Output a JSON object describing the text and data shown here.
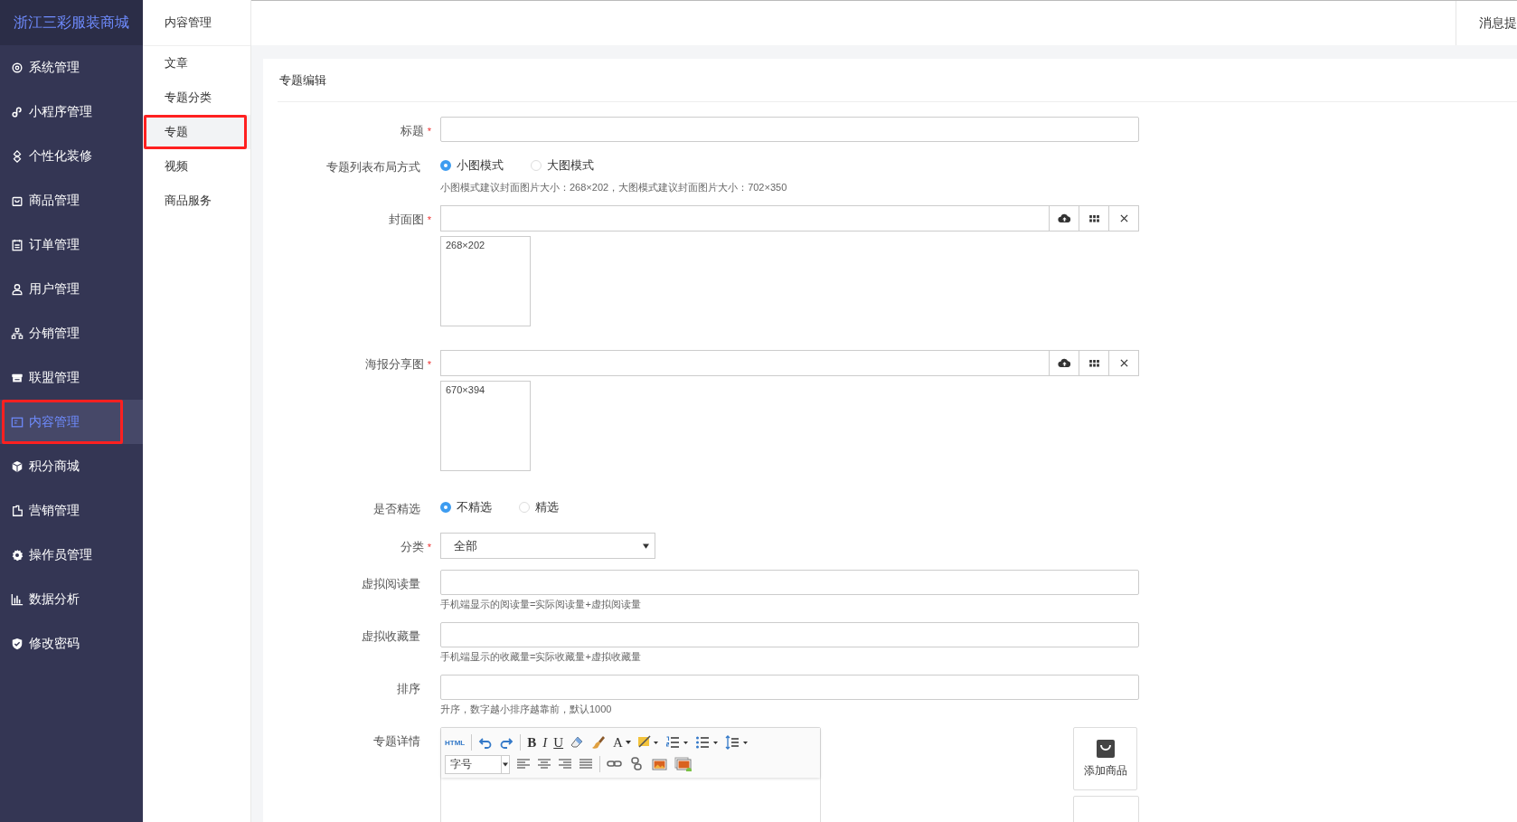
{
  "sidebar": {
    "brand": "浙江三彩服装商城",
    "items": [
      {
        "label": "系统管理",
        "selected": false,
        "highlighted": false
      },
      {
        "label": "小程序管理",
        "selected": false,
        "highlighted": false
      },
      {
        "label": "个性化装修",
        "selected": false,
        "highlighted": false
      },
      {
        "label": "商品管理",
        "selected": false,
        "highlighted": false
      },
      {
        "label": "订单管理",
        "selected": false,
        "highlighted": false
      },
      {
        "label": "用户管理",
        "selected": false,
        "highlighted": false
      },
      {
        "label": "分销管理",
        "selected": false,
        "highlighted": false
      },
      {
        "label": "联盟管理",
        "selected": false,
        "highlighted": false
      },
      {
        "label": "内容管理",
        "selected": true,
        "highlighted": true
      },
      {
        "label": "积分商城",
        "selected": false,
        "highlighted": false
      },
      {
        "label": "营销管理",
        "selected": false,
        "highlighted": false
      },
      {
        "label": "操作员管理",
        "selected": false,
        "highlighted": false
      },
      {
        "label": "数据分析",
        "selected": false,
        "highlighted": false
      },
      {
        "label": "修改密码",
        "selected": false,
        "highlighted": false
      }
    ]
  },
  "subnav": {
    "title": "内容管理",
    "items": [
      {
        "label": "文章",
        "selected": false,
        "highlighted": false
      },
      {
        "label": "专题分类",
        "selected": false,
        "highlighted": false
      },
      {
        "label": "专题",
        "selected": true,
        "highlighted": true
      },
      {
        "label": "视频",
        "selected": false,
        "highlighted": false
      },
      {
        "label": "商品服务",
        "selected": false,
        "highlighted": false
      }
    ]
  },
  "topbar": {
    "notice": "消息提"
  },
  "form": {
    "title": "专题编辑",
    "fields": [
      {
        "kind": "text",
        "label": "标题",
        "required": true
      },
      {
        "kind": "radio",
        "label": "专题列表布局方式",
        "required": false,
        "options": [
          {
            "label": "小图模式",
            "selected": true
          },
          {
            "label": "大图模式",
            "selected": false
          }
        ],
        "hint": "小图模式建议封面图片大小：268×202，大图模式建议封面图片大小：702×350"
      },
      {
        "kind": "image",
        "label": "封面图",
        "required": true,
        "size": "268×202"
      },
      {
        "kind": "image",
        "label": "海报分享图",
        "required": true,
        "size": "670×394"
      },
      {
        "kind": "radio",
        "label": "是否精选",
        "required": false,
        "options": [
          {
            "label": "不精选",
            "selected": true
          },
          {
            "label": "精选",
            "selected": false
          }
        ]
      },
      {
        "kind": "select",
        "label": "分类",
        "required": true,
        "value": "全部"
      },
      {
        "kind": "text",
        "label": "虚拟阅读量",
        "required": false,
        "hint": "手机端显示的阅读量=实际阅读量+虚拟阅读量"
      },
      {
        "kind": "text",
        "label": "虚拟收藏量",
        "required": false,
        "hint": "手机端显示的收藏量=实际收藏量+虚拟收藏量"
      },
      {
        "kind": "text",
        "label": "排序",
        "required": false,
        "hint": "升序，数字越小排序越靠前，默认1000"
      },
      {
        "kind": "editor",
        "label": "专题详情",
        "required": false
      }
    ]
  },
  "editor": {
    "rows": [
      [
        {
          "kind": "html",
          "label": "HTML"
        },
        {
          "kind": "sep"
        },
        {
          "kind": "undo"
        },
        {
          "kind": "redo"
        },
        {
          "kind": "sep"
        },
        {
          "kind": "bold",
          "label": "B"
        },
        {
          "kind": "italic",
          "label": "I"
        },
        {
          "kind": "underline",
          "label": "U"
        },
        {
          "kind": "eraser"
        },
        {
          "kind": "brush"
        },
        {
          "kind": "fontcolor",
          "label": "A"
        },
        {
          "kind": "highlight"
        },
        {
          "kind": "ol"
        },
        {
          "kind": "ul"
        },
        {
          "kind": "lineheight"
        }
      ],
      [
        {
          "kind": "fontsize",
          "label": "字号"
        },
        {
          "kind": "alignleft"
        },
        {
          "kind": "aligncenter"
        },
        {
          "kind": "alignright"
        },
        {
          "kind": "justify"
        },
        {
          "kind": "sep"
        },
        {
          "kind": "link"
        },
        {
          "kind": "unlink"
        },
        {
          "kind": "image"
        },
        {
          "kind": "images"
        }
      ]
    ]
  },
  "add_product": "添加商品",
  "required_mark": "*"
}
